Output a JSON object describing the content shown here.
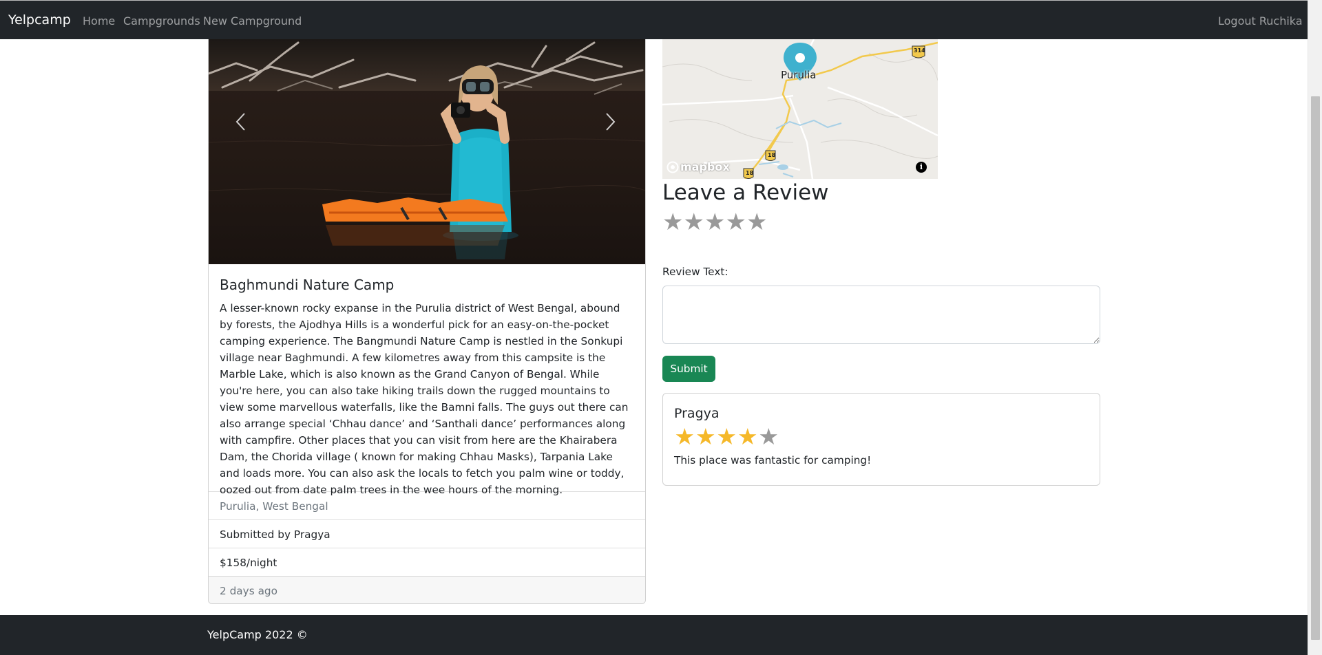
{
  "navbar": {
    "brand": "Yelpcamp",
    "links": [
      "Home",
      "Campgrounds",
      "New Campground"
    ],
    "logout": "Logout Ruchika"
  },
  "campground": {
    "title": "Baghmundi Nature Camp",
    "description": "A lesser-known rocky expanse in the Purulia district of West Bengal, abound by forests, the Ajodhya Hills is a wonderful pick for an easy-on-the-pocket camping experience. The Bangmundi Nature Camp is nestled in the Sonkupi village near Baghmundi. A few kilometres away from this campsite is the Marble Lake, which is also known as the Grand Canyon of Bengal. While you're here, you can also take hiking trails down the rugged mountains to view some marvellous waterfalls, like the Bamni falls. The guys out there can also arrange special ‘Chhau dance’ and ‘Santhali dance’ performances along with campfire. Other places that you can visit from here are the Khairabera Dam, the Chorida village ( known for making Chhau Masks), Tarpania Lake and loads more. You can also ask the locals to fetch you palm wine or toddy, oozed out from date palm trees in the wee hours of the morning.",
    "location": "Purulia, West Bengal",
    "submitted_by": "Submitted by Pragya",
    "price": "$158/night",
    "posted": "2 days ago"
  },
  "map": {
    "city": "Purulia",
    "attribution": "mapbox",
    "road_labels": [
      "314",
      "18",
      "18"
    ],
    "info": "i"
  },
  "review_form": {
    "heading": "Leave a Review",
    "rating": 0,
    "max_rating": 5,
    "text_label": "Review Text:",
    "text_value": "",
    "submit_label": "Submit"
  },
  "reviews": [
    {
      "author": "Pragya",
      "rating": 4,
      "max_rating": 5,
      "body": "This place was fantastic for camping!"
    }
  ],
  "footer": {
    "text": "YelpCamp 2022 ©"
  },
  "colors": {
    "navbar_bg": "#212529",
    "submit_btn": "#198754",
    "star_filled": "#f5b829",
    "star_empty": "#999999"
  }
}
